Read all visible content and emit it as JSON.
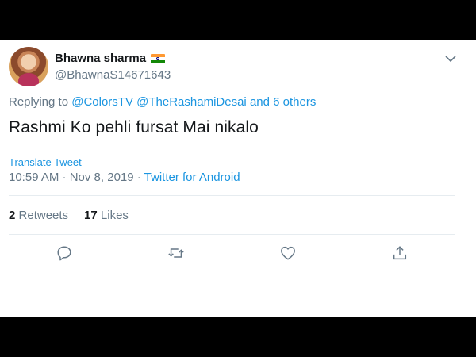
{
  "tweet": {
    "display_name": "Bhawna sharma",
    "flag_icon": "india-flag-icon",
    "handle": "@BhawnaS14671643",
    "replying_prefix": "Replying to",
    "reply_mention_1": "@ColorsTV",
    "reply_mention_2": "@TheRashamiDesai",
    "reply_others": "and 6 others",
    "text": "Rashmi Ko pehli fursat Mai nikalo",
    "translate_label": "Translate Tweet",
    "timestamp": "10:59 AM · Nov 8, 2019",
    "separator": " · ",
    "source": "Twitter for Android",
    "retweets_count": "2",
    "retweets_label": "Retweets",
    "likes_count": "17",
    "likes_label": "Likes",
    "colors": {
      "link": "#1b95e0",
      "text": "#14171a",
      "muted": "#657786"
    }
  },
  "actions": [
    {
      "icon": "reply-icon"
    },
    {
      "icon": "retweet-icon"
    },
    {
      "icon": "like-icon"
    },
    {
      "icon": "share-icon"
    }
  ],
  "menu": {
    "icon": "chevron-down-icon"
  }
}
